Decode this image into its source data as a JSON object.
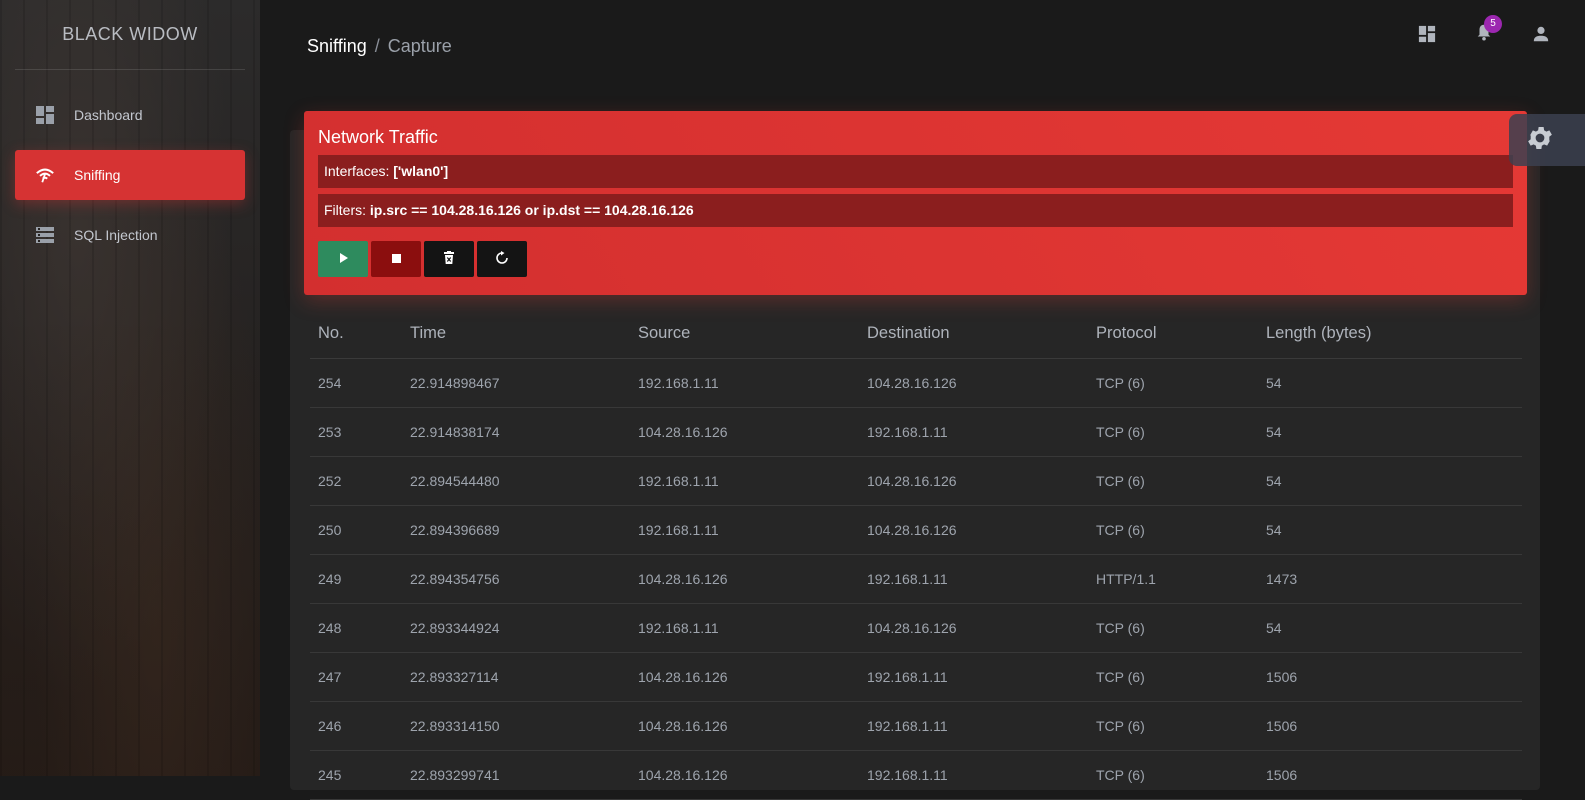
{
  "sidebar": {
    "brand": "BLACK WIDOW",
    "items": [
      {
        "label": "Dashboard",
        "icon": "dashboard-icon",
        "active": false
      },
      {
        "label": "Sniffing",
        "icon": "wifi-icon",
        "active": true
      },
      {
        "label": "SQL Injection",
        "icon": "database-icon",
        "active": false
      }
    ]
  },
  "header": {
    "breadcrumb": [
      "Sniffing",
      "Capture"
    ],
    "separator": "/",
    "notifications_count": "5"
  },
  "capture": {
    "title": "Network Traffic",
    "interfaces_label": "Interfaces:",
    "interfaces_value": "['wlan0']",
    "filters_label": "Filters:",
    "filters_value": "ip.src == 104.28.16.126 or ip.dst == 104.28.16.126"
  },
  "table": {
    "columns": [
      "No.",
      "Time",
      "Source",
      "Destination",
      "Protocol",
      "Length (bytes)"
    ],
    "rows": [
      [
        "254",
        "22.914898467",
        "192.168.1.11",
        "104.28.16.126",
        "TCP (6)",
        "54"
      ],
      [
        "253",
        "22.914838174",
        "104.28.16.126",
        "192.168.1.11",
        "TCP (6)",
        "54"
      ],
      [
        "252",
        "22.894544480",
        "192.168.1.11",
        "104.28.16.126",
        "TCP (6)",
        "54"
      ],
      [
        "250",
        "22.894396689",
        "192.168.1.11",
        "104.28.16.126",
        "TCP (6)",
        "54"
      ],
      [
        "249",
        "22.894354756",
        "104.28.16.126",
        "192.168.1.11",
        "HTTP/1.1",
        "1473"
      ],
      [
        "248",
        "22.893344924",
        "192.168.1.11",
        "104.28.16.126",
        "TCP (6)",
        "54"
      ],
      [
        "247",
        "22.893327114",
        "104.28.16.126",
        "192.168.1.11",
        "TCP (6)",
        "1506"
      ],
      [
        "246",
        "22.893314150",
        "104.28.16.126",
        "192.168.1.11",
        "TCP (6)",
        "1506"
      ],
      [
        "245",
        "22.893299741",
        "104.28.16.126",
        "192.168.1.11",
        "TCP (6)",
        "1506"
      ]
    ]
  },
  "colors": {
    "accent": "#d63333",
    "start_button": "#2e8b5e",
    "stop_button": "#8b0e0e",
    "badge": "#9c27b0"
  }
}
